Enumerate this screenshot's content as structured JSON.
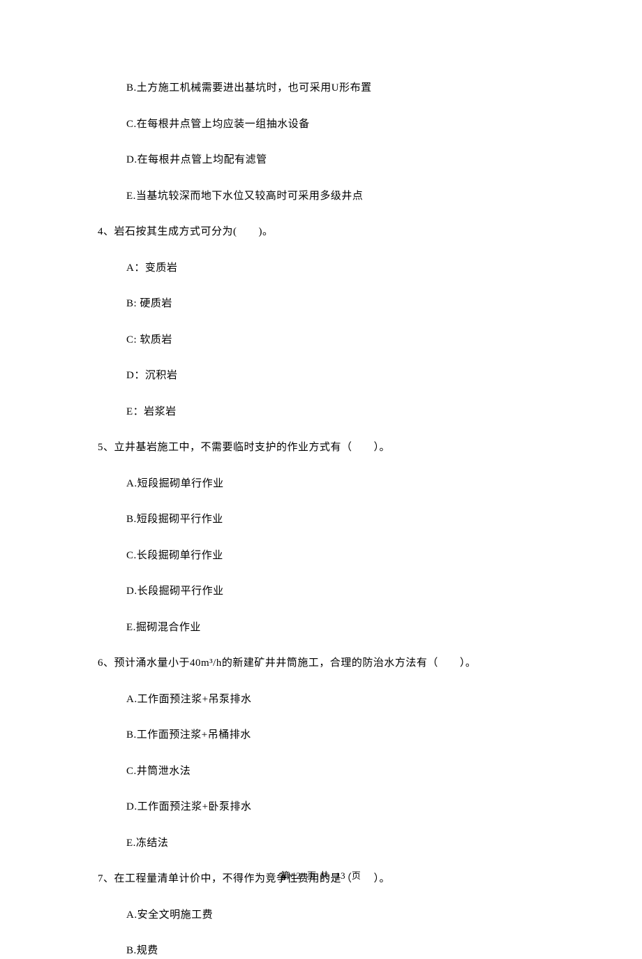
{
  "q3_options": {
    "b": "B.土方施工机械需要进出基坑时，也可采用U形布置",
    "c": "C.在每根井点管上均应装一组抽水设备",
    "d": "D.在每根井点管上均配有滤管",
    "e": "E.当基坑较深而地下水位又较高时可采用多级井点"
  },
  "q4": {
    "text": "4、岩石按其生成方式可分为(　　)。",
    "options": {
      "a": "A：变质岩",
      "b": "B: 硬质岩",
      "c": "C: 软质岩",
      "d": "D：沉积岩",
      "e": "E：岩浆岩"
    }
  },
  "q5": {
    "text": "5、立井基岩施工中，不需要临时支护的作业方式有（　　）。",
    "options": {
      "a": "A.短段掘砌单行作业",
      "b": "B.短段掘砌平行作业",
      "c": "C.长段掘砌单行作业",
      "d": "D.长段掘砌平行作业",
      "e": "E.掘砌混合作业"
    }
  },
  "q6": {
    "text": "6、预计涌水量小于40m³/h的新建矿井井筒施工，合理的防治水方法有（　　）。",
    "options": {
      "a": "A.工作面预注浆+吊泵排水",
      "b": "B.工作面预注浆+吊桶排水",
      "c": "C.井筒泄水法",
      "d": "D.工作面预注浆+卧泵排水",
      "e": "E.冻结法"
    }
  },
  "q7": {
    "text": "7、在工程量清单计价中，不得作为竞争性费用的是（　　）。",
    "options": {
      "a": "A.安全文明施工费",
      "b": "B.规费"
    }
  },
  "footer": {
    "prefix": "第",
    "current": "2",
    "middle": "页 共",
    "total": "13",
    "suffix": "页"
  }
}
